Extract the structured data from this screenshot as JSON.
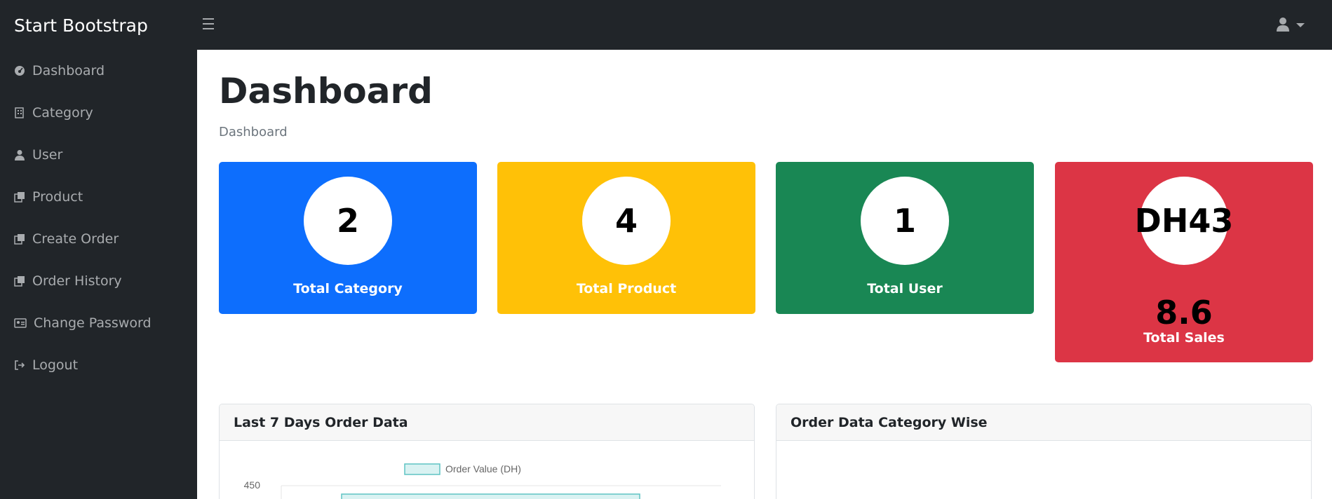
{
  "topbar": {
    "brand": "Start Bootstrap",
    "menu_icon": "hamburger-icon",
    "user_icon": "user-icon"
  },
  "sidebar": {
    "items": [
      {
        "label": "Dashboard",
        "icon": "tachometer-icon"
      },
      {
        "label": "Category",
        "icon": "building-icon"
      },
      {
        "label": "User",
        "icon": "user-tie-icon"
      },
      {
        "label": "Product",
        "icon": "copy-icon"
      },
      {
        "label": "Create Order",
        "icon": "copy-icon"
      },
      {
        "label": "Order History",
        "icon": "copy-icon"
      },
      {
        "label": "Change Password",
        "icon": "id-card-icon"
      },
      {
        "label": "Logout",
        "icon": "sign-out-icon"
      }
    ]
  },
  "main": {
    "title": "Dashboard",
    "breadcrumb": "Dashboard",
    "cards": [
      {
        "value": "2",
        "label": "Total Category",
        "color": "#0d6efd"
      },
      {
        "value": "4",
        "label": "Total Product",
        "color": "#ffc107"
      },
      {
        "value": "1",
        "label": "Total User",
        "color": "#198754"
      },
      {
        "value": "DH43",
        "sub_value": "8.6",
        "label": "Total Sales",
        "color": "#dc3545"
      }
    ],
    "panels": [
      {
        "title": "Last 7 Days Order Data"
      },
      {
        "title": "Order Data Category Wise"
      }
    ]
  },
  "chart_data": {
    "type": "bar",
    "legend": [
      "Order Value (DH)"
    ],
    "y_ticks_visible": [
      450
    ],
    "series": [
      {
        "name": "Order Value (DH)",
        "values": [
          430
        ]
      }
    ],
    "colors": {
      "fill": "#d9f2f2",
      "stroke": "#5fc3c3"
    }
  }
}
